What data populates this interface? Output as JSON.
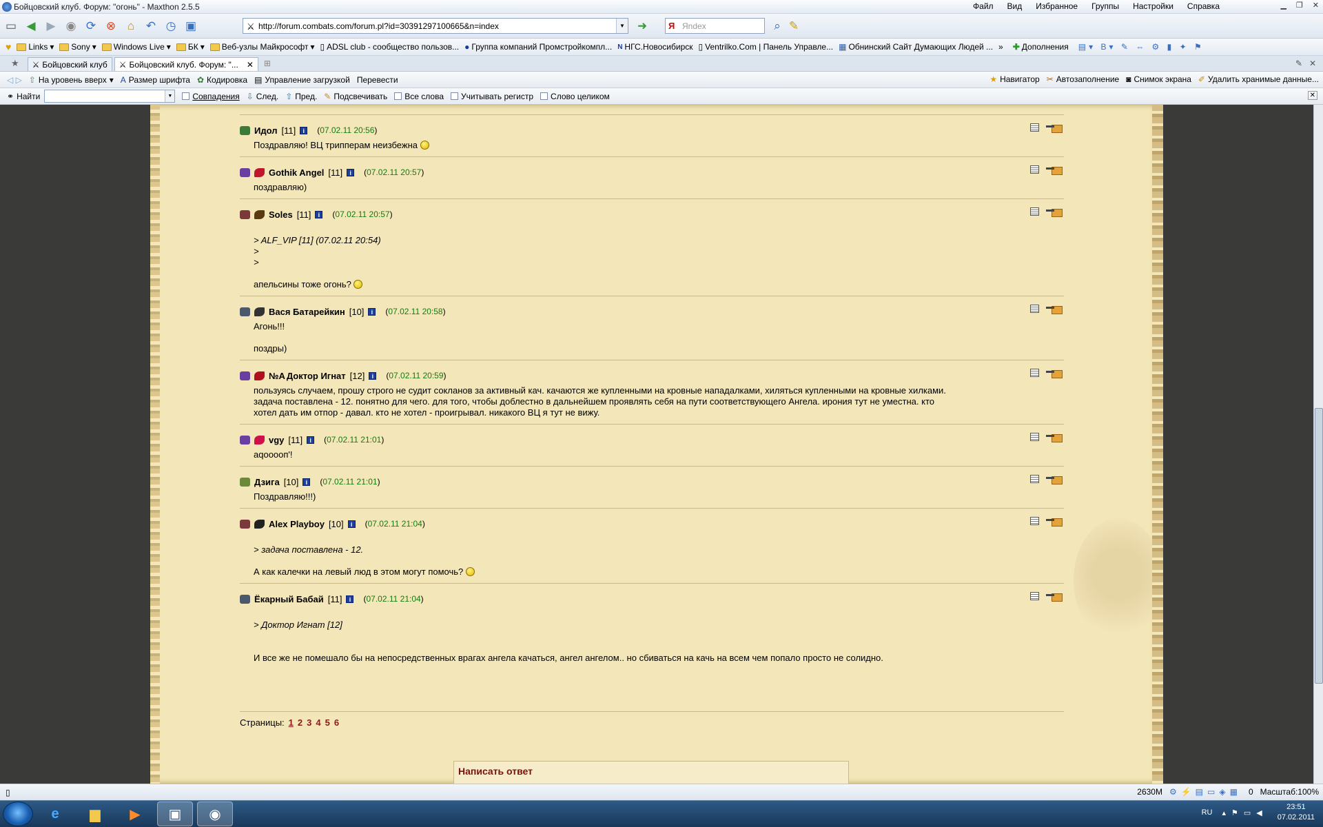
{
  "window": {
    "title": "Бойцовский клуб. Форум: \"огонь\" - Maxthon 2.5.5"
  },
  "menu": [
    "Файл",
    "Вид",
    "Избранное",
    "Группы",
    "Настройки",
    "Справка"
  ],
  "address": {
    "url": "http://forum.combats.com/forum.pl?id=30391297100665&n=index"
  },
  "search": {
    "placeholder": "Яndex"
  },
  "bookmarks": [
    "Links",
    "Sony",
    "Windows Live",
    "БК",
    "Веб-узлы Майкрософт",
    "ADSL club - сообщество пользов...",
    "Группа компаний Промстройкомпл...",
    "НГС.Новосибирск",
    "Ventrilko.Com | Панель Управле...",
    "Обнинский Сайт Думающих Людей ...",
    "Дополнения"
  ],
  "tabs": [
    "Бойцовский клуб",
    "Бойцовский клуб. Форум: \"..."
  ],
  "toolbar2": {
    "left": [
      "На уровень вверх",
      "Размер шрифта",
      "Кодировка",
      "Управление загрузкой",
      "Перевести"
    ],
    "right": [
      "Навигатор",
      "Автозаполнение",
      "Снимок экрана",
      "Удалить хранимые данные..."
    ]
  },
  "findbar": {
    "label": "Найти",
    "matches": "Совпадения",
    "next": "След.",
    "prev": "Пред.",
    "highlight": "Подсвечивать",
    "all_words": "Все слова",
    "case": "Учитывать регистр",
    "whole": "Слово целиком"
  },
  "posts": [
    {
      "nick": "Идол",
      "level": "[11]",
      "date": "07.02.11 20:56",
      "lines": [
        "Поздравляю! ВЦ трипперам неизбежна"
      ],
      "smile": true,
      "ico": "#3b7a3b",
      "ico2": ""
    },
    {
      "nick": "Gothik Angel",
      "level": "[11]",
      "date": "07.02.11 20:57",
      "lines": [
        "поздравляю)"
      ],
      "smile": false,
      "ico": "#6b3fa0",
      "ico2": "#c0162c"
    },
    {
      "nick": "Soles",
      "level": "[11]",
      "date": "07.02.11 20:57",
      "quote": [
        "> ALF_VIP [11] (07.02.11 20:54)",
        ">",
        ">"
      ],
      "lines": [
        "апельсины тоже огонь?"
      ],
      "smile": true,
      "ico": "#7a3a3a",
      "ico2": "#5a3a10"
    },
    {
      "nick": "Вася Батарейкин",
      "level": "[10]",
      "date": "07.02.11 20:58",
      "lines": [
        "Агонь!!!",
        "",
        "поздры)"
      ],
      "smile": false,
      "ico": "#4a5a6a",
      "ico2": "#333333"
    },
    {
      "nick": "Доктор Игнат",
      "prefix": "№A",
      "level": "[12]",
      "date": "07.02.11 20:59",
      "lines": [
        "пользуясь случаем, прошу строго не судит сокланов за активный кач. качаются же купленными на кровные нападалками, хиляться купленными на кровные хилками.",
        "задача поставлена - 12. понятно для чего. для того, чтобы доблестно в дальнейшем проявлять себя на пути соответствующего Ангела. ирония тут не уместна. кто",
        "хотел дать им отпор - давал. кто не хотел - проигрывал. никакого ВЦ я тут не вижу."
      ],
      "smile": false,
      "ico": "#6b3fa0",
      "ico2": "#b0101e"
    },
    {
      "nick": "vgy",
      "level": "[11]",
      "date": "07.02.11 21:01",
      "lines": [
        "аqooooп'!"
      ],
      "smile": false,
      "ico": "#6b3fa0",
      "ico2": "#d0104a"
    },
    {
      "nick": "Дзига",
      "level": "[10]",
      "date": "07.02.11 21:01",
      "lines": [
        "Поздравляю!!!)"
      ],
      "smile": false,
      "ico": "#6a8a3a",
      "ico2": ""
    },
    {
      "nick": "Alex Playboy",
      "level": "[10]",
      "date": "07.02.11 21:04",
      "quote": [
        "> задача поставлена - 12."
      ],
      "lines": [
        "А как калечки на левый люд в этом могут помочь?"
      ],
      "smile": true,
      "ico": "#7a3a3a",
      "ico2": "#222222"
    },
    {
      "nick": "Ёкарный Бабай",
      "level": "[11]",
      "date": "07.02.11 21:04",
      "quote": [
        "> Доктор Игнат [12]"
      ],
      "lines": [
        "",
        "И все же не помешало бы на непосредственных врагах ангела качаться, ангел ангелом.. но сбиваться на качь на всем чем попало просто не солидно."
      ],
      "smile": false,
      "ico": "#4a5a6a",
      "ico2": ""
    }
  ],
  "pager": {
    "label": "Страницы:",
    "pages": [
      "1",
      "2",
      "3",
      "4",
      "5",
      "6"
    ]
  },
  "reply": {
    "title": "Написать ответ"
  },
  "status": {
    "memory": "2630M",
    "zoom": "Масштаб:100%",
    "counter": "0"
  },
  "taskbar": {
    "lang": "RU",
    "time": "23:51",
    "date": "07.02.2011"
  }
}
